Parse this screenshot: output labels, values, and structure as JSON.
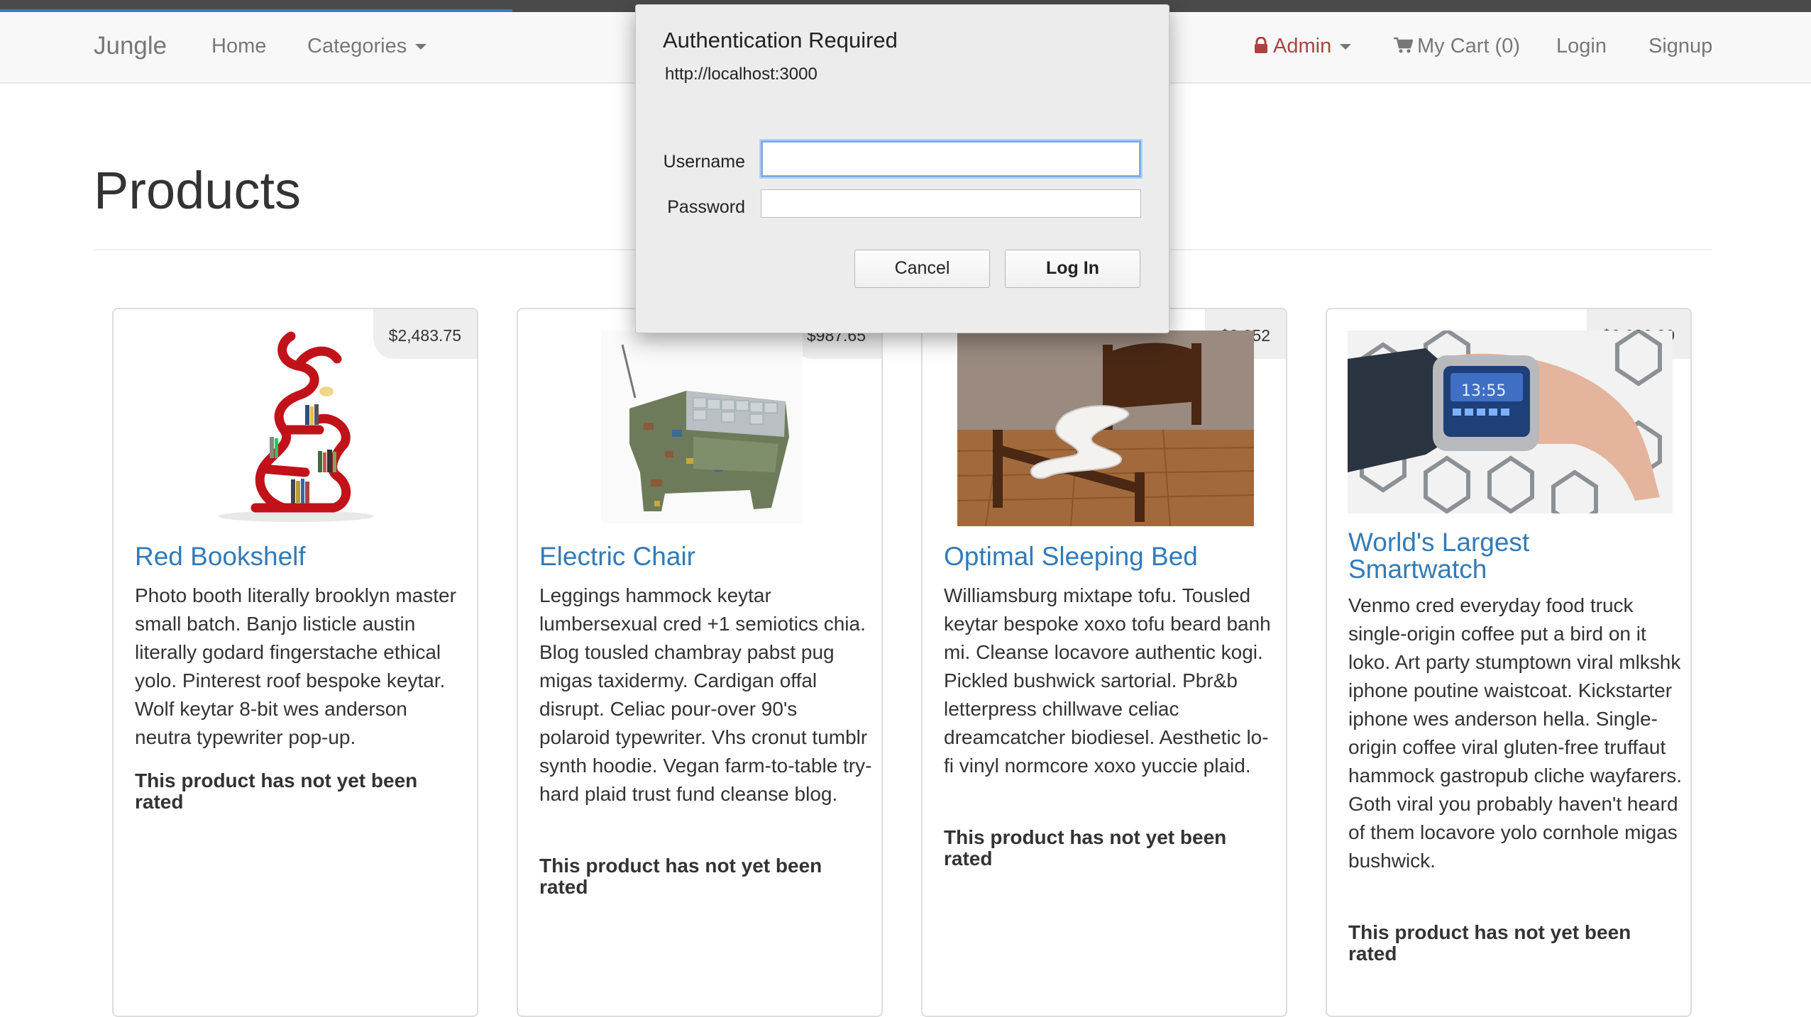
{
  "navbar": {
    "brand": "Jungle",
    "home": "Home",
    "categories": "Categories",
    "admin": "Admin",
    "cart": "My Cart (0)",
    "login": "Login",
    "signup": "Signup",
    "colors": {
      "background": "#f8f8f8",
      "link": "#777777",
      "admin": "#a94442"
    }
  },
  "page": {
    "title": "Products"
  },
  "products": [
    {
      "price": "$2,483.75",
      "name": "Red Bookshelf",
      "description": "Photo booth literally brooklyn master small batch. Banjo listicle austin literally godard fingerstache ethical yolo. Pinterest roof bespoke keytar. Wolf keytar 8-bit wes anderson neutra typewriter pop-up.",
      "rating": "This product has not yet been rated",
      "image_icon": "red-bookshelf-image"
    },
    {
      "price": "$987.65",
      "name": "Electric Chair",
      "description": "Leggings hammock keytar lumbersexual cred +1 semiotics chia. Blog tousled chambray pabst pug migas taxidermy. Cardigan offal disrupt. Celiac pour-over 90's polaroid typewriter. Vhs cronut tumblr synth hoodie. Vegan farm-to-table try-hard plaid trust fund cleanse blog.",
      "rating": "This product has not yet been rated",
      "image_icon": "circuit-chair-image"
    },
    {
      "price": "$3,052",
      "name": "Optimal Sleeping Bed",
      "description": "Williamsburg mixtape tofu. Tousled keytar bespoke xoxo tofu beard banh mi. Cleanse locavore authentic kogi. Pickled bushwick sartorial. Pbr&b letterpress chillwave celiac dreamcatcher biodiesel. Aesthetic lo-fi vinyl normcore xoxo yuccie plaid.",
      "rating": "This product has not yet been rated",
      "image_icon": "zigzag-bed-image"
    },
    {
      "price": "$2,026.29",
      "name": "World's Largest Smartwatch",
      "description": "Venmo cred everyday food truck single-origin coffee put a bird on it loko. Art party stumptown viral mlkshk iphone poutine waistcoat. Kickstarter iphone wes anderson hella. Single-origin coffee viral gluten-free truffaut hammock gastropub cliche wayfarers. Goth viral you probably haven't heard of them locavore yolo cornhole migas bushwick.",
      "rating": "This product has not yet been rated",
      "image_icon": "wrist-smartwatch-image"
    }
  ],
  "auth_dialog": {
    "title": "Authentication Required",
    "url": "http://localhost:3000",
    "username_label": "Username",
    "password_label": "Password",
    "username_value": "",
    "password_value": "",
    "cancel": "Cancel",
    "login": "Log In"
  }
}
